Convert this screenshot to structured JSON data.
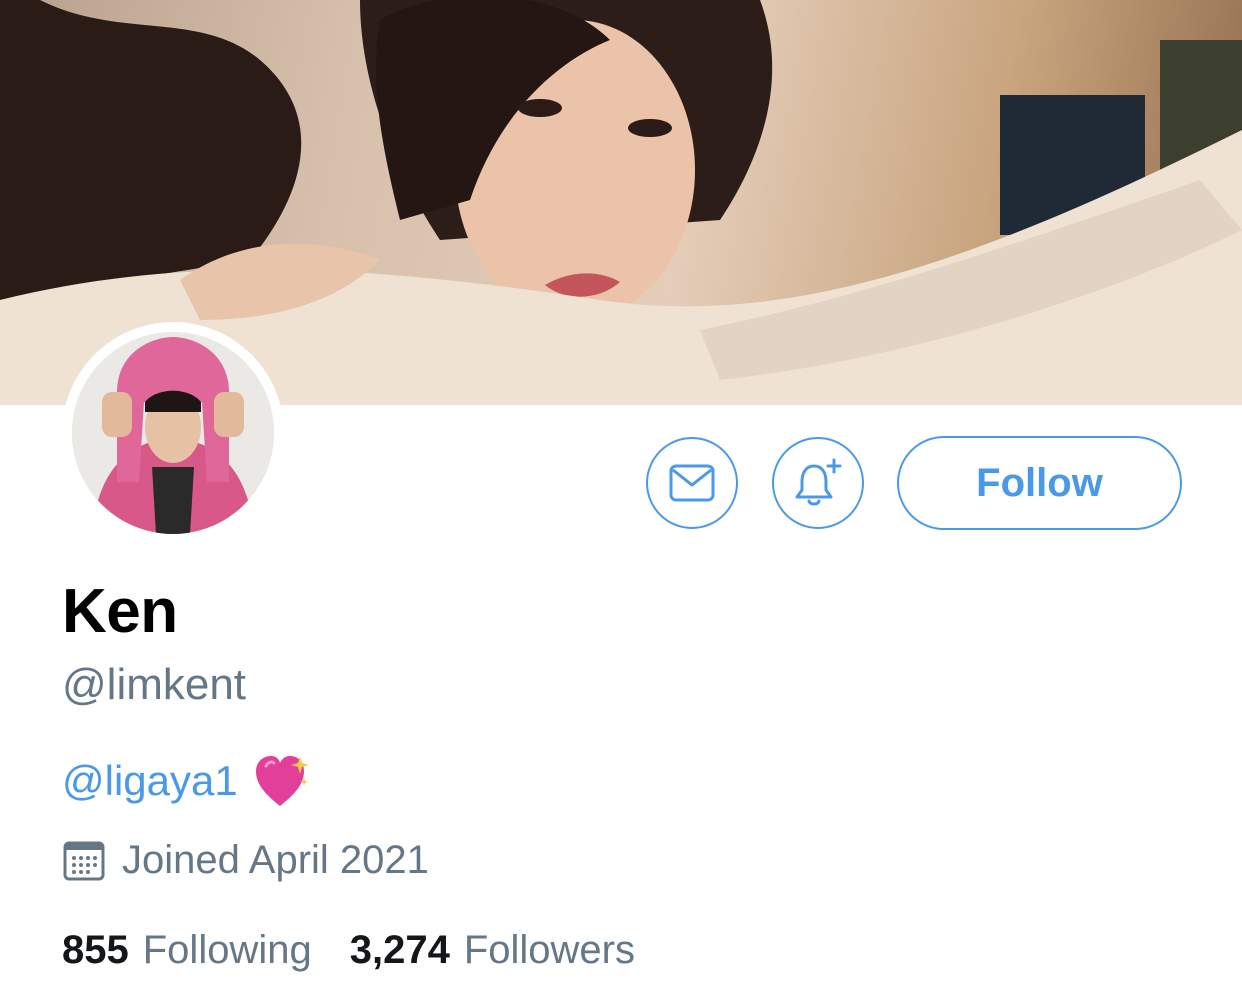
{
  "header": {
    "banner_image": "banner-photo",
    "avatar_image": "avatar-photo"
  },
  "actions": {
    "message_icon": "envelope-icon",
    "notify_icon": "bell-plus-icon",
    "follow_label": "Follow"
  },
  "profile": {
    "display_name": "Ken",
    "handle": "@limkent",
    "bio_mention": "@ligaya1",
    "bio_emoji": "sparkling-heart-icon",
    "joined_icon": "calendar-icon",
    "joined_text": "Joined April 2021"
  },
  "stats": {
    "following_count": "855",
    "following_label": "Following",
    "followers_count": "3,274",
    "followers_label": "Followers"
  },
  "colors": {
    "accent": "#4a99e9",
    "secondary_text": "#657786",
    "primary_text": "#14171a"
  }
}
